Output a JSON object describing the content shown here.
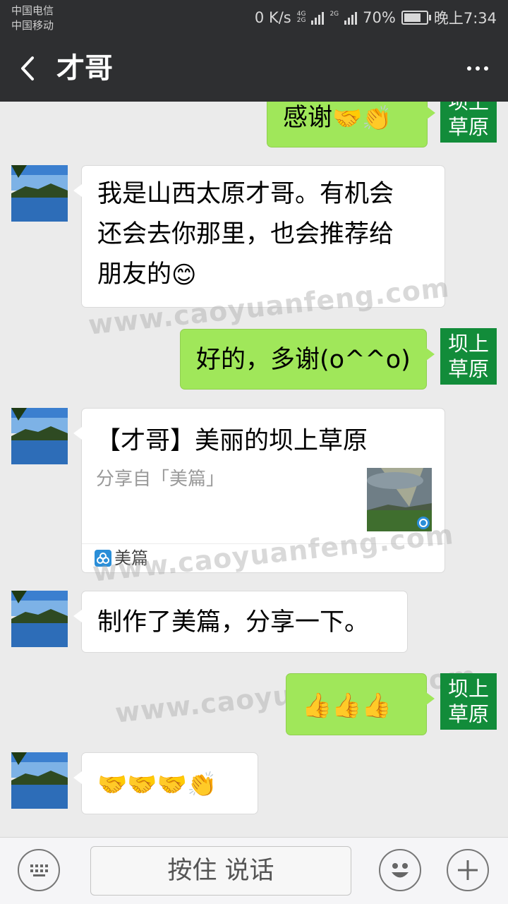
{
  "status_bar": {
    "carrier1": "中国电信",
    "carrier2": "中国移动",
    "speed": "0 K/s",
    "net1_top": "4G",
    "net1_bottom": "2G",
    "net2": "2G",
    "battery_percent": "70%",
    "time": "晚上7:34"
  },
  "header": {
    "title": "才哥"
  },
  "self_avatar_text": "坝上\n草原",
  "messages": [
    {
      "side": "right",
      "text": "感谢",
      "emoji": [
        "handshake",
        "clap"
      ]
    },
    {
      "side": "left",
      "lines": [
        "我是山西太原才哥。有机会",
        "还会去你那里，也会推荐给",
        "朋友的"
      ],
      "emoji": [
        "smile"
      ]
    },
    {
      "side": "right",
      "text": "好的，多谢(o^^o)"
    },
    {
      "side": "left",
      "type": "link",
      "title": "【才哥】美丽的坝上草原",
      "subtitle": "分享自「美篇」",
      "source": "美篇"
    },
    {
      "side": "left",
      "text": "制作了美篇，分享一下。"
    },
    {
      "side": "right",
      "text": "",
      "emoji": [
        "thumbs-up",
        "thumbs-up",
        "thumbs-up"
      ]
    },
    {
      "side": "left",
      "text": "",
      "emoji": [
        "handshake",
        "handshake",
        "handshake",
        "clap"
      ]
    }
  ],
  "watermark": "www.caoyuanfeng.com",
  "input_bar": {
    "hold_to_talk": "按住 说话"
  },
  "colors": {
    "bar_bg": "#2e2f31",
    "chat_bg": "#ebebeb",
    "self_bubble": "#a0e75a",
    "self_avatar": "#128c3a"
  }
}
